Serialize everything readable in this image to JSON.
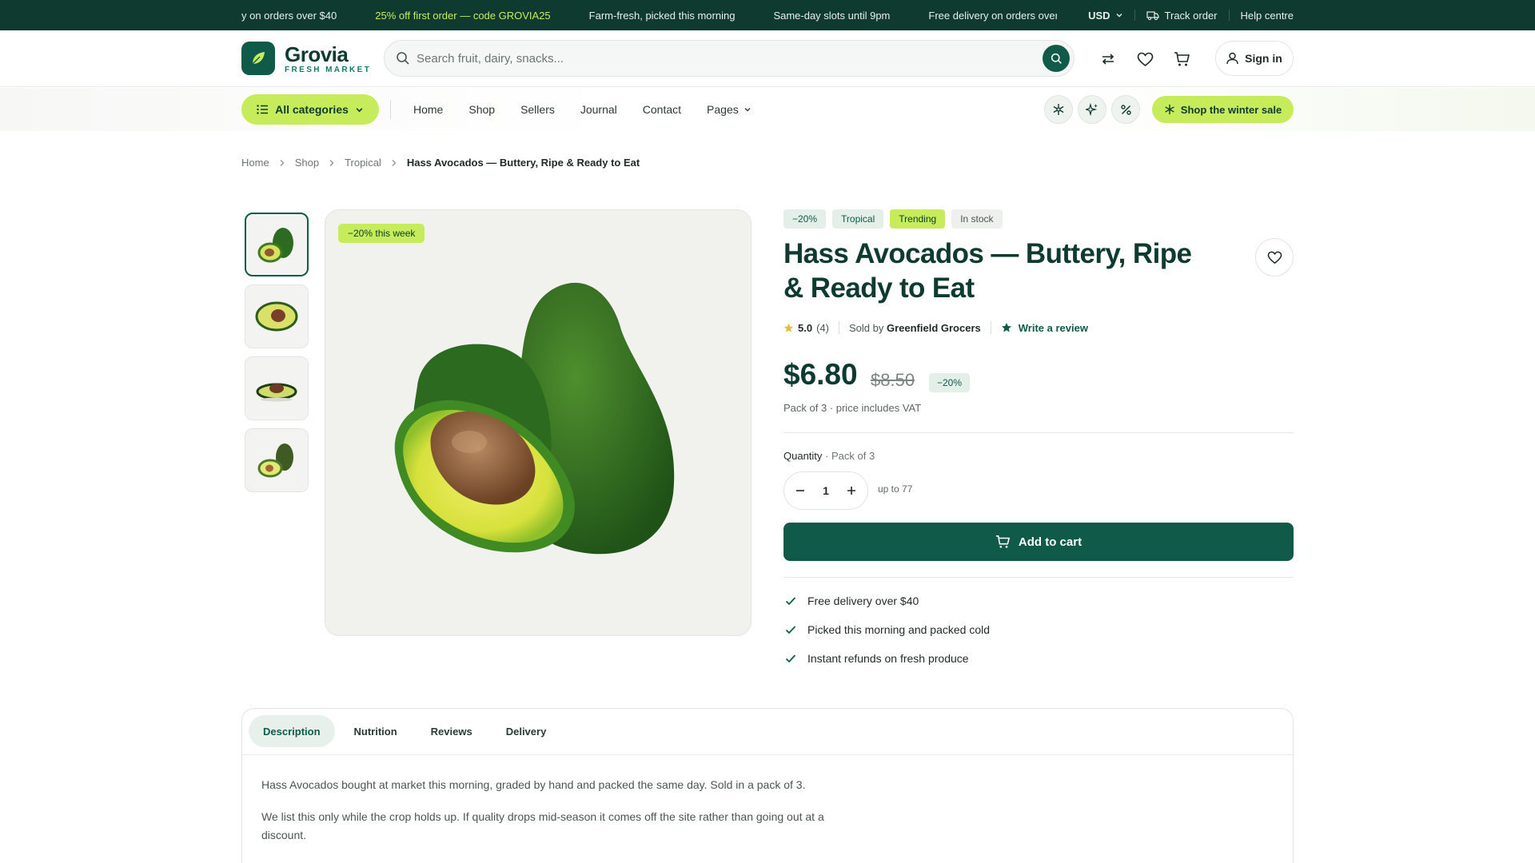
{
  "announcement": {
    "items": [
      "y on orders over $40",
      "25% off first order — code GROVIA25",
      "Farm-fresh, picked this morning",
      "Same-day slots until 9pm",
      "Free delivery on orders over"
    ],
    "currency": "USD",
    "track_order": "Track order",
    "help": "Help centre"
  },
  "brand": {
    "name": "Grovia",
    "tagline": "FRESH MARKET"
  },
  "search": {
    "placeholder": "Search fruit, dairy, snacks..."
  },
  "account": {
    "sign_in": "Sign in"
  },
  "nav": {
    "all_categories": "All categories",
    "links": [
      "Home",
      "Shop",
      "Sellers",
      "Journal",
      "Contact",
      "Pages"
    ],
    "sale_button": "Shop the winter sale"
  },
  "breadcrumb": [
    "Home",
    "Shop",
    "Tropical",
    "Hass Avocados — Buttery, Ripe & Ready to Eat"
  ],
  "gallery": {
    "badge": "−20% this week"
  },
  "product": {
    "tags": [
      "−20%",
      "Tropical",
      "Trending",
      "In stock"
    ],
    "title": "Hass Avocados — Buttery, Ripe & Ready to Eat",
    "rating": "5.0",
    "review_count": "(4)",
    "sold_by_label": "Sold by",
    "seller": "Greenfield Grocers",
    "write_review": "Write a review",
    "price": "$6.80",
    "old_price": "$8.50",
    "discount": "−20%",
    "pack_note": "Pack of 3 · price includes VAT",
    "quantity_label": "Quantity",
    "quantity_pack": "· Pack of 3",
    "quantity": "1",
    "stock_limit": "up to 77",
    "add_to_cart": "Add to cart",
    "perks": [
      "Free delivery over $40",
      "Picked this morning and packed cold",
      "Instant refunds on fresh produce"
    ]
  },
  "tabs": {
    "items": [
      "Description",
      "Nutrition",
      "Reviews",
      "Delivery"
    ],
    "active": "Description",
    "description": [
      "Hass Avocados bought at market this morning, graded by hand and packed the same day. Sold in a pack of 3.",
      "We list this only while the crop holds up. If quality drops mid-season it comes off the site rather than going out at a discount."
    ]
  },
  "colors": {
    "brand_dark": "#0f3a30",
    "brand": "#0f5a48",
    "lime": "#c6ec5b"
  }
}
